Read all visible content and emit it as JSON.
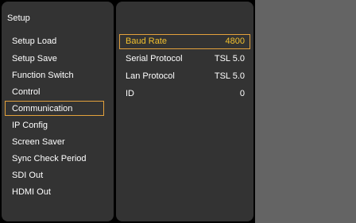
{
  "setup_menu": {
    "title": "Setup",
    "items": [
      {
        "label": "Setup Load"
      },
      {
        "label": "Setup Save"
      },
      {
        "label": "Function Switch"
      },
      {
        "label": "Control"
      },
      {
        "label": "Communication"
      },
      {
        "label": "IP Config"
      },
      {
        "label": "Screen Saver"
      },
      {
        "label": "Sync Check Period"
      },
      {
        "label": "SDI Out"
      },
      {
        "label": "HDMI Out"
      }
    ],
    "selected": "Communication"
  },
  "communication": {
    "params": [
      {
        "label": "Baud Rate",
        "value": "4800"
      },
      {
        "label": "Serial Protocol",
        "value": "TSL 5.0"
      },
      {
        "label": "Lan Protocol",
        "value": "TSL 5.0"
      },
      {
        "label": "ID",
        "value": "0"
      }
    ],
    "selected": "Baud Rate"
  },
  "colors": {
    "panel_bg": "#333333",
    "screen_bg": "#000000",
    "outside_bg": "#646464",
    "highlight_border": "#e3a13c",
    "highlight_text": "#f3c02e",
    "text": "#ffffff"
  }
}
